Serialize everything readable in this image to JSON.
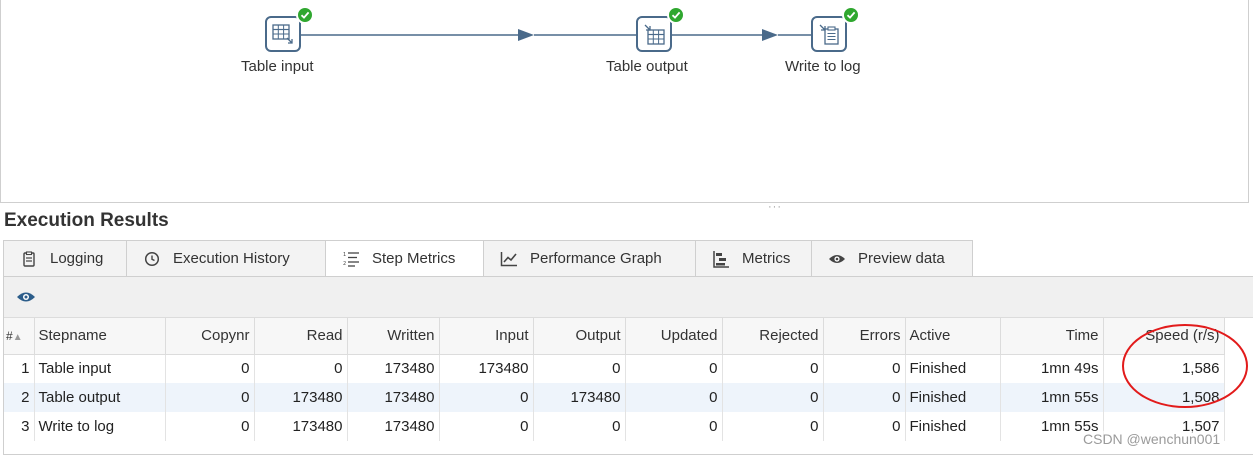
{
  "canvas": {
    "steps": [
      {
        "label": "Table input",
        "icon": "table-input-icon",
        "status": "success"
      },
      {
        "label": "Table output",
        "icon": "table-output-icon",
        "status": "success"
      },
      {
        "label": "Write to log",
        "icon": "write-to-log-icon",
        "status": "success"
      }
    ]
  },
  "results": {
    "title": "Execution Results",
    "tabs": [
      {
        "label": "Logging",
        "icon": "logging-icon"
      },
      {
        "label": "Execution History",
        "icon": "history-icon"
      },
      {
        "label": "Step Metrics",
        "icon": "step-metrics-icon",
        "active": true
      },
      {
        "label": "Performance Graph",
        "icon": "graph-icon"
      },
      {
        "label": "Metrics",
        "icon": "metrics-icon"
      },
      {
        "label": "Preview data",
        "icon": "eye-icon"
      }
    ],
    "toolbar_icon": "eye-icon",
    "columns": [
      "#",
      "Stepname",
      "Copynr",
      "Read",
      "Written",
      "Input",
      "Output",
      "Updated",
      "Rejected",
      "Errors",
      "Active",
      "Time",
      "Speed (r/s)"
    ],
    "rows": [
      [
        "1",
        "Table input",
        "0",
        "0",
        "173480",
        "173480",
        "0",
        "0",
        "0",
        "0",
        "Finished",
        "1mn 49s",
        "1,586"
      ],
      [
        "2",
        "Table output",
        "0",
        "173480",
        "173480",
        "0",
        "173480",
        "0",
        "0",
        "0",
        "Finished",
        "1mn 55s",
        "1,508"
      ],
      [
        "3",
        "Write to log",
        "0",
        "173480",
        "173480",
        "0",
        "0",
        "0",
        "0",
        "0",
        "Finished",
        "1mn 55s",
        "1,507"
      ]
    ]
  },
  "colors": {
    "success": "#2fa72f",
    "annotation": "#e21b1b",
    "connector": "#4a6a8a"
  },
  "watermark": "CSDN @wenchun001"
}
